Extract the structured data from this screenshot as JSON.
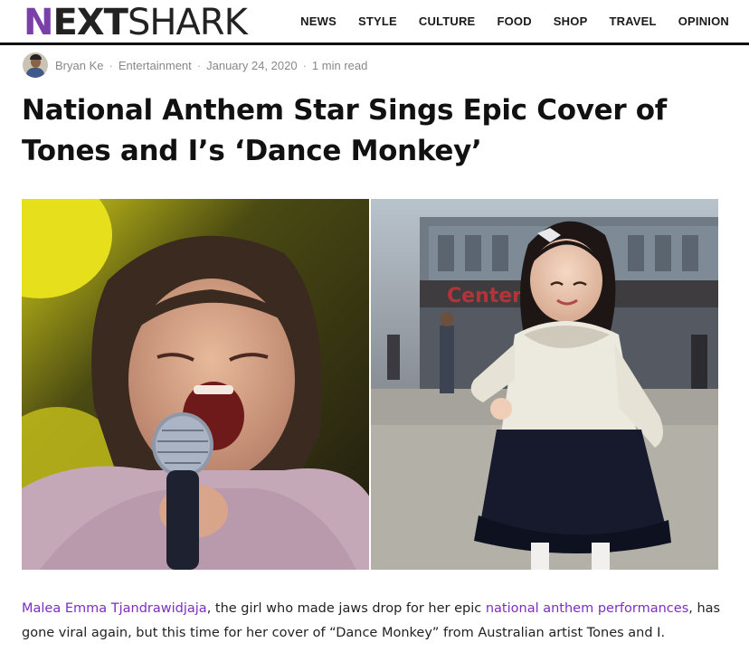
{
  "site": {
    "logo_n": "N",
    "logo_ext": "EXT",
    "logo_shark": "SHARK",
    "brand_color": "#7a3fa8"
  },
  "nav": {
    "items": [
      {
        "label": "NEWS"
      },
      {
        "label": "STYLE"
      },
      {
        "label": "CULTURE"
      },
      {
        "label": "FOOD"
      },
      {
        "label": "SHOP"
      },
      {
        "label": "TRAVEL"
      },
      {
        "label": "OPINION"
      }
    ]
  },
  "article": {
    "author": "Bryan Ke",
    "category": "Entertainment",
    "date": "January 24, 2020",
    "read_time": "1 min read",
    "separator": "·",
    "title": "National Anthem Star Sings Epic Cover of Tones and I’s ‘Dance Monkey’",
    "body": {
      "link1": "Malea Emma Tjandrawidjaja",
      "text1": ", the girl who made jaws drop for her epic ",
      "link2": "national anthem performances",
      "text2": ", has gone viral again, but this time for her cover of “Dance Monkey” from Australian artist Tones and I."
    },
    "link_color": "#7a2fc2"
  }
}
